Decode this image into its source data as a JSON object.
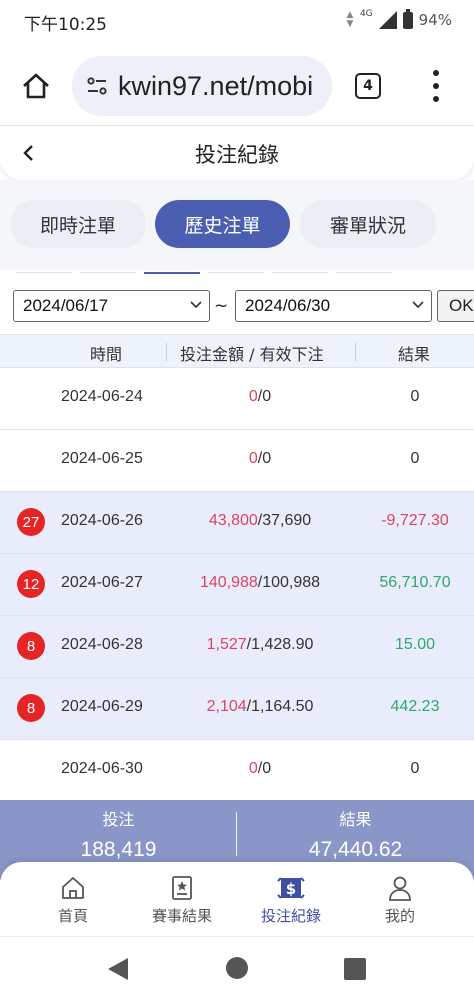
{
  "status_bar": {
    "time": "下午10:25",
    "network": "4G",
    "battery": "94%"
  },
  "browser": {
    "url": "kwin97.net/mobi",
    "tab_count": "4"
  },
  "header": {
    "title": "投注紀錄"
  },
  "tabs": [
    {
      "label": "即時注單",
      "active": false
    },
    {
      "label": "歷史注單",
      "active": true
    },
    {
      "label": "審單狀況",
      "active": false
    }
  ],
  "filter": {
    "start_date": "2024/06/17",
    "separator": "~",
    "end_date": "2024/06/30",
    "ok_label": "OK"
  },
  "table": {
    "headers": {
      "time": "時間",
      "amount": "投注金額 / 有效下注",
      "result": "結果"
    },
    "rows": [
      {
        "badge": "",
        "date": "2024-06-24",
        "bet": "0",
        "valid": "/0",
        "result": "0",
        "result_type": "zero",
        "highlight": false
      },
      {
        "badge": "",
        "date": "2024-06-25",
        "bet": "0",
        "valid": "/0",
        "result": "0",
        "result_type": "zero",
        "highlight": false
      },
      {
        "badge": "27",
        "date": "2024-06-26",
        "bet": "43,800",
        "valid": "/37,690",
        "result": "-9,727.30",
        "result_type": "neg",
        "highlight": true
      },
      {
        "badge": "12",
        "date": "2024-06-27",
        "bet": "140,988",
        "valid": "/100,988",
        "result": "56,710.70",
        "result_type": "pos",
        "highlight": true
      },
      {
        "badge": "8",
        "date": "2024-06-28",
        "bet": "1,527",
        "valid": "/1,428.90",
        "result": "15.00",
        "result_type": "pos",
        "highlight": true
      },
      {
        "badge": "8",
        "date": "2024-06-29",
        "bet": "2,104",
        "valid": "/1,164.50",
        "result": "442.23",
        "result_type": "pos",
        "highlight": true
      },
      {
        "badge": "",
        "date": "2024-06-30",
        "bet": "0",
        "valid": "/0",
        "result": "0",
        "result_type": "zero",
        "highlight": false
      }
    ]
  },
  "summary": {
    "bet_label": "投注",
    "bet_value": "188,419",
    "result_label": "結果",
    "result_value": "47,440.62"
  },
  "bottom_nav": [
    {
      "label": "首頁",
      "icon": "home-icon",
      "active": false
    },
    {
      "label": "賽事結果",
      "icon": "results-icon",
      "active": false
    },
    {
      "label": "投注紀錄",
      "icon": "bet-record-icon",
      "active": true
    },
    {
      "label": "我的",
      "icon": "profile-icon",
      "active": false
    }
  ],
  "colors": {
    "accent": "#4b5fb2",
    "negative": "#d9455f",
    "positive": "#2fa86a",
    "badge": "#e52525",
    "summary_bg": "#8a96c7"
  }
}
